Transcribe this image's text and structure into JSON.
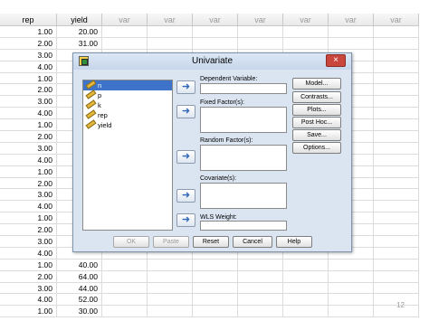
{
  "sheet": {
    "headers": [
      "rep",
      "yield",
      "var",
      "var",
      "var",
      "var",
      "var",
      "var",
      "var"
    ],
    "rows": [
      [
        "1.00",
        "20.00"
      ],
      [
        "2.00",
        "31.00"
      ],
      [
        "3.00",
        ""
      ],
      [
        "4.00",
        ""
      ],
      [
        "1.00",
        ""
      ],
      [
        "2.00",
        ""
      ],
      [
        "3.00",
        ""
      ],
      [
        "4.00",
        ""
      ],
      [
        "1.00",
        ""
      ],
      [
        "2.00",
        ""
      ],
      [
        "3.00",
        ""
      ],
      [
        "4.00",
        ""
      ],
      [
        "1.00",
        ""
      ],
      [
        "2.00",
        ""
      ],
      [
        "3.00",
        ""
      ],
      [
        "4.00",
        ""
      ],
      [
        "1.00",
        ""
      ],
      [
        "2.00",
        ""
      ],
      [
        "3.00",
        ""
      ],
      [
        "4.00",
        ""
      ],
      [
        "1.00",
        "40.00"
      ],
      [
        "2.00",
        "64.00"
      ],
      [
        "3.00",
        "44.00"
      ],
      [
        "4.00",
        "52.00"
      ],
      [
        "1.00",
        "30.00"
      ]
    ],
    "page_number": "12"
  },
  "dialog": {
    "title": "Univariate",
    "close_label": "×",
    "variables": [
      "n",
      "p",
      "k",
      "rep",
      "yield"
    ],
    "selected_variable": "n",
    "arrow_label": "➜",
    "labels": {
      "dependent": "Dependent Variable:",
      "fixed": "Fixed Factor(s):",
      "random": "Random Factor(s):",
      "covariate": "Covariate(s):",
      "wls": "WLS Weight:"
    },
    "side_buttons": [
      "Model...",
      "Contrasts...",
      "Plots...",
      "Post Hoc...",
      "Save...",
      "Options..."
    ],
    "bottom_buttons": {
      "ok": "OK",
      "paste": "Paste",
      "reset": "Reset",
      "cancel": "Cancel",
      "help": "Help"
    }
  }
}
